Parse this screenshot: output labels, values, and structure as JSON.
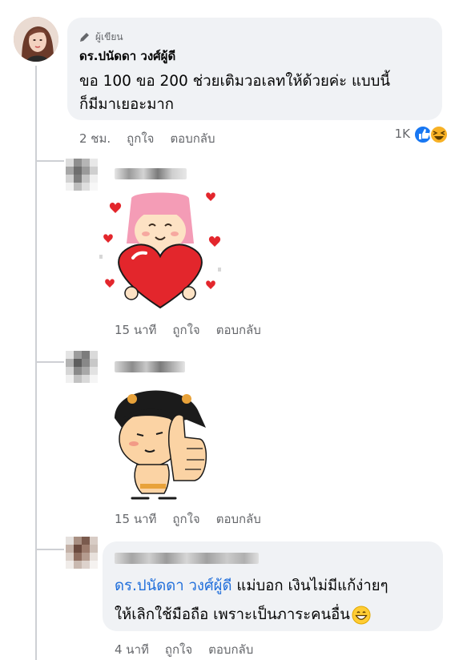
{
  "post_comment": {
    "author_badge_label": "ผู้เขียน",
    "author_name": "ดร.ปนัดดา วงศ์ผู้ดี",
    "text_line1": "ขอ 100 ขอ 200 ช่วยเติมวอเลทให้ด้วยค่ะ แบบนี้",
    "text_line2": "ก็มีมาเยอะมาก",
    "time": "2 ชม.",
    "like_label": "ถูกใจ",
    "reply_label": "ตอบกลับ",
    "reaction_count": "1K",
    "reaction_icons": [
      "like-icon",
      "laugh-icon"
    ]
  },
  "replies": [
    {
      "sticker": "girl-heart-sticker",
      "time": "15 นาที",
      "like_label": "ถูกใจ",
      "reply_label": "ตอบกลับ"
    },
    {
      "sticker": "thumbs-up-sticker",
      "time": "15 นาที",
      "like_label": "ถูกใจ",
      "reply_label": "ตอบกลับ"
    },
    {
      "mention": "ดร.ปนัดดา วงศ์ผู้ดี",
      "text_after_mention": " แม่บอก เงินไม่มีแก้ง่ายๆ",
      "text_line2": "ให้เลิกใช้มือถือ เพราะเป็นภาระคนอื่น",
      "emoji": "grinning-emoji",
      "time": "4 นาที",
      "like_label": "ถูกใจ",
      "reply_label": "ตอบกลับ"
    }
  ],
  "colors": {
    "bubble": "#f0f2f5",
    "meta_text": "#65676b",
    "mention": "#216fdb",
    "like_blue": "#1877f2",
    "laugh_yellow": "#f7b125"
  }
}
